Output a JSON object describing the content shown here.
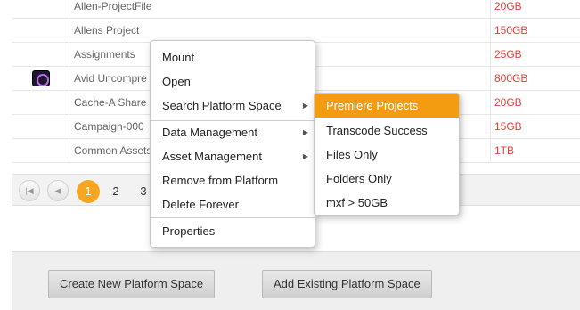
{
  "table": {
    "rows": [
      {
        "name": "Allen-ProjectFile",
        "size": "20GB",
        "icon": ""
      },
      {
        "name": "Allens Project",
        "size": "150GB",
        "icon": ""
      },
      {
        "name": "Assignments",
        "size": "25GB",
        "icon": ""
      },
      {
        "name": "Avid Uncompre",
        "size": "800GB",
        "icon": "avid-media-icon"
      },
      {
        "name": "Cache-A Share",
        "size": "20GB",
        "icon": ""
      },
      {
        "name": "Campaign-000",
        "size": "15GB",
        "icon": ""
      },
      {
        "name": "Common Assets",
        "size": "1TB",
        "icon": ""
      }
    ]
  },
  "pager": {
    "first_icon": "first-page-icon",
    "prev_icon": "prev-page-icon",
    "pages": [
      "1",
      "2",
      "3"
    ],
    "current": "1"
  },
  "context_menu": {
    "items": [
      {
        "label": "Mount"
      },
      {
        "label": "Open"
      },
      {
        "label": "Search Platform Space",
        "submenu": true
      },
      {
        "label": "Data Management",
        "submenu": true
      },
      {
        "label": "Asset Management",
        "submenu": true
      },
      {
        "label": "Remove from Platform"
      },
      {
        "label": "Delete Forever"
      },
      {
        "label": "Properties"
      }
    ],
    "arrow": "▶"
  },
  "search_submenu": {
    "items": [
      {
        "label": "Premiere Projects",
        "highlighted": true
      },
      {
        "label": "Transcode Success"
      },
      {
        "label": "Files Only"
      },
      {
        "label": "Folders Only"
      },
      {
        "label": "mxf > 50GB"
      }
    ],
    "highlight_color": "#f39c12"
  },
  "actions": {
    "create_label": "Create New Platform Space",
    "add_existing_label": "Add Existing Platform Space"
  },
  "colors": {
    "size_text": "#e0403a",
    "active_page": "#f5a623"
  }
}
